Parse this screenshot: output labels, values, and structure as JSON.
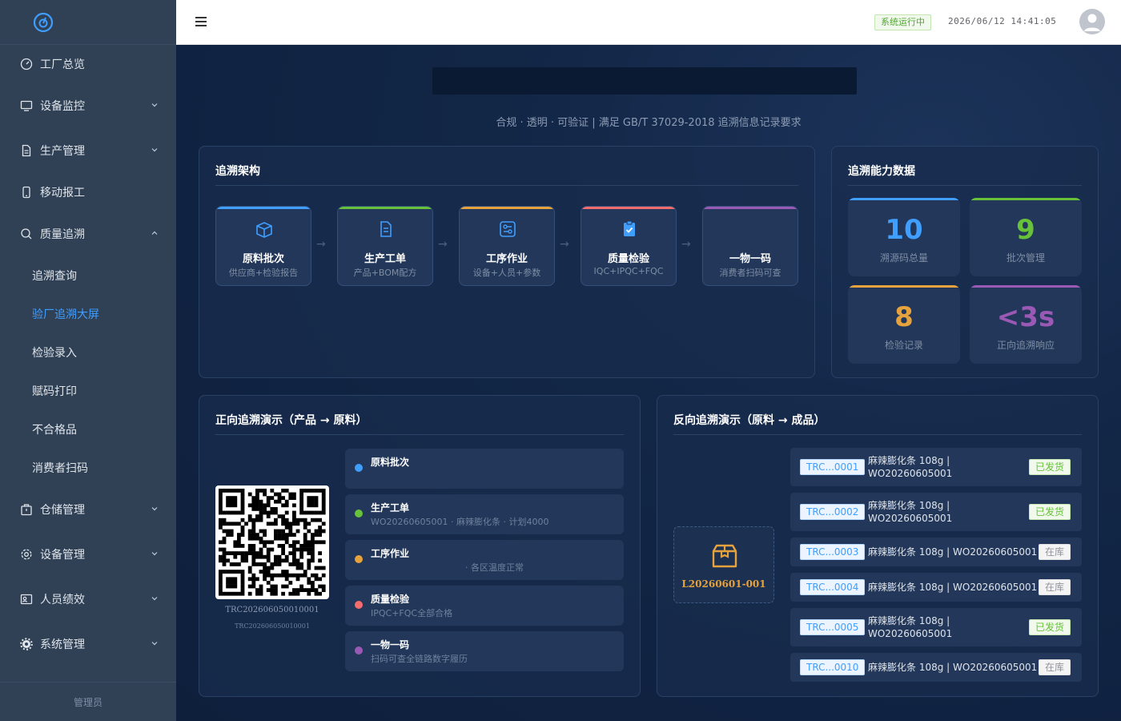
{
  "sidebar": {
    "items": [
      {
        "label": "工厂总览",
        "icon": "dashboard-icon"
      },
      {
        "label": "设备监控",
        "icon": "monitor-icon",
        "expandable": true
      },
      {
        "label": "生产管理",
        "icon": "document-icon",
        "expandable": true
      },
      {
        "label": "移动报工",
        "icon": "mobile-icon"
      },
      {
        "label": "质量追溯",
        "icon": "search-icon",
        "expanded": true
      }
    ],
    "sub_items": [
      {
        "label": "追溯查询"
      },
      {
        "label": "验厂追溯大屏",
        "active": true
      },
      {
        "label": "检验录入"
      },
      {
        "label": "赋码打印"
      },
      {
        "label": "不合格品"
      },
      {
        "label": "消费者扫码"
      }
    ],
    "items_after": [
      {
        "label": "仓储管理",
        "icon": "warehouse-icon"
      },
      {
        "label": "设备管理",
        "icon": "gear-icon"
      },
      {
        "label": "人员绩效",
        "icon": "person-card-icon"
      },
      {
        "label": "系统管理",
        "icon": "settings-icon"
      }
    ],
    "footer": "管理员"
  },
  "header": {
    "status": "系统运行中",
    "datetime": "2026/06/12 14:41:05"
  },
  "main": {
    "subtitle": "合规 · 透明 · 可验证 | 满足 GB/T 37029-2018 追溯信息记录要求",
    "architecture": {
      "title": "追溯架构",
      "cards": [
        {
          "title": "原料批次",
          "desc": "供应商+检验报告",
          "color": "#409eff",
          "icon": "box-icon"
        },
        {
          "title": "生产工单",
          "desc": "产品+BOM配方",
          "color": "#67c23a",
          "icon": "document-icon"
        },
        {
          "title": "工序作业",
          "desc": "设备+人员+参数",
          "color": "#e6a23c",
          "icon": "process-icon"
        },
        {
          "title": "质量检验",
          "desc": "IQC+IPQC+FQC",
          "color": "#f56c6c",
          "icon": "clipboard-check-icon"
        },
        {
          "title": "一物一码",
          "desc": "消费者扫码可查",
          "color": "#9b59b6",
          "icon": "qrcode-icon"
        }
      ]
    },
    "stats": {
      "title": "追溯能力数据",
      "items": [
        {
          "value": "10",
          "label": "溯源码总量",
          "color": "#409eff"
        },
        {
          "value": "9",
          "label": "批次管理",
          "color": "#67c23a"
        },
        {
          "value": "8",
          "label": "检验记录",
          "color": "#e6a23c"
        },
        {
          "value": "<3s",
          "label": "正向追溯响应",
          "color": "#9b59b6"
        }
      ]
    },
    "forward": {
      "title": "正向追溯演示（产品 → 原料）",
      "code_primary": "TRC202606050010001",
      "code_secondary": "TRC202606050010001",
      "steps": [
        {
          "title": "原料批次",
          "desc": "",
          "color": "#409eff"
        },
        {
          "title": "生产工单",
          "desc": "WO20260605001 · 麻辣膨化条 · 计划4000",
          "color": "#67c23a"
        },
        {
          "title": "工序作业",
          "desc": "· 各区温度正常",
          "color": "#e6a23c"
        },
        {
          "title": "质量检验",
          "desc": "IPQC+FQC全部合格",
          "color": "#f56c6c"
        },
        {
          "title": "一物一码",
          "desc": "扫码可查全链路数字履历",
          "color": "#9b59b6"
        }
      ]
    },
    "reverse": {
      "title": "反向追溯演示（原料 → 成品）",
      "lot": "L20260601-001",
      "rows": [
        {
          "code": "TRC...0001",
          "desc": "麻辣膨化条 108g | WO20260605001",
          "status": "已发货",
          "type": "shipped"
        },
        {
          "code": "TRC...0002",
          "desc": "麻辣膨化条 108g | WO20260605001",
          "status": "已发货",
          "type": "shipped"
        },
        {
          "code": "TRC...0003",
          "desc": "麻辣膨化条 108g | WO20260605001",
          "status": "在库",
          "type": "stock"
        },
        {
          "code": "TRC...0004",
          "desc": "麻辣膨化条 108g | WO20260605001",
          "status": "在库",
          "type": "stock"
        },
        {
          "code": "TRC...0005",
          "desc": "麻辣膨化条 108g | WO20260605001",
          "status": "已发货",
          "type": "shipped"
        },
        {
          "code": "TRC...0010",
          "desc": "麻辣膨化条 108g | WO20260605001",
          "status": "在库",
          "type": "stock"
        }
      ]
    }
  }
}
